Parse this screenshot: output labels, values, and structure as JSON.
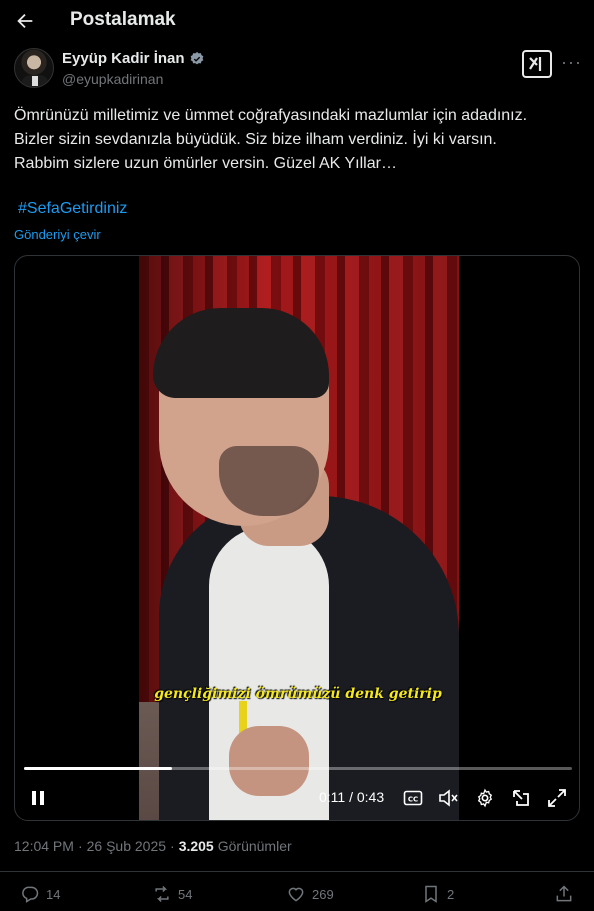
{
  "header": {
    "title": "Postalamak"
  },
  "author": {
    "name": "Eyyüp Kadir İnan",
    "handle": "@eyupkadirinan"
  },
  "tweet": {
    "lines": [
      "Ömrünüzü milletimiz ve ümmet coğrafyasındaki mazlumlar için adadınız.",
      "Bizler sizin sevdanızla büyüdük. Siz bize ilham verdiniz. İyi ki varsın.",
      "Rabbim sizlere uzun ömürler versin. Güzel AK Yıllar…"
    ],
    "hashtag": "#SefaGetirdiniz",
    "translate": "Gönderiyi çevir"
  },
  "video": {
    "caption": "gençliğimizi ömrümüzü denk getirip",
    "time": "0:11 / 0:43",
    "progress": 0.27
  },
  "meta": {
    "time": "12:04 PM",
    "separator": "·",
    "date": "26 Şub 2025",
    "views": "3.205",
    "views_label": "Görünümler"
  },
  "actions": {
    "replies": "14",
    "reposts": "54",
    "likes": "269",
    "bookmarks": "2"
  },
  "colors": {
    "accent": "#1d9bf0",
    "muted": "#71767b",
    "caption": "#f5e81c"
  }
}
